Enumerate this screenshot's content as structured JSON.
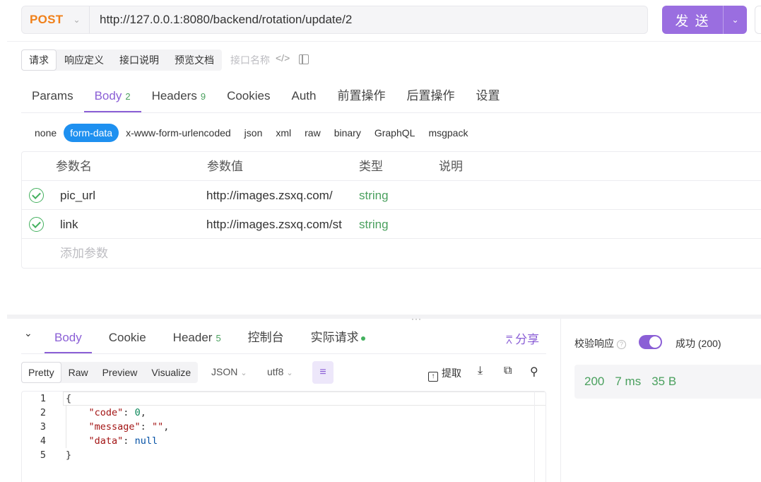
{
  "request": {
    "method": "POST",
    "url": "http://127.0.0.1:8080/backend/rotation/update/2",
    "send_label": "发 送"
  },
  "doc_tabs": [
    {
      "label": "请求",
      "active": true
    },
    {
      "label": "响应定义",
      "active": false
    },
    {
      "label": "接口说明",
      "active": false
    },
    {
      "label": "预览文档",
      "active": false
    }
  ],
  "interface_name_placeholder": "接口名称",
  "main_tabs": [
    {
      "label": "Params",
      "count": ""
    },
    {
      "label": "Body",
      "count": "2"
    },
    {
      "label": "Headers",
      "count": "9"
    },
    {
      "label": "Cookies",
      "count": ""
    },
    {
      "label": "Auth",
      "count": ""
    },
    {
      "label": "前置操作",
      "count": ""
    },
    {
      "label": "后置操作",
      "count": ""
    },
    {
      "label": "设置",
      "count": ""
    }
  ],
  "active_main_tab": "Body",
  "body_types": [
    "none",
    "form-data",
    "x-www-form-urlencoded",
    "json",
    "xml",
    "raw",
    "binary",
    "GraphQL",
    "msgpack"
  ],
  "active_body_type": "form-data",
  "params": {
    "headers": {
      "name": "参数名",
      "value": "参数值",
      "type": "类型",
      "desc": "说明"
    },
    "rows": [
      {
        "name": "pic_url",
        "value": "http://images.zsxq.com/",
        "type": "string",
        "enabled": true
      },
      {
        "name": "link",
        "value": "http://images.zsxq.com/st",
        "type": "string",
        "enabled": true
      }
    ],
    "add_placeholder": "添加参数"
  },
  "response": {
    "tabs": [
      {
        "label": "Body",
        "count": ""
      },
      {
        "label": "Cookie",
        "count": ""
      },
      {
        "label": "Header",
        "count": "5"
      },
      {
        "label": "控制台",
        "count": ""
      },
      {
        "label": "实际请求",
        "count": ""
      }
    ],
    "share_label": "分享",
    "formats": [
      "Pretty",
      "Raw",
      "Preview",
      "Visualize"
    ],
    "active_format": "Pretty",
    "lang": "JSON",
    "encoding": "utf8",
    "extract_label": "提取",
    "code_lines": [
      "1",
      "2",
      "3",
      "4",
      "5"
    ],
    "verify_label": "校验响应",
    "verify_enabled": true,
    "verify_result": "成功 (200)",
    "status_code": "200",
    "time": "7 ms",
    "size": "35 B"
  },
  "colors": {
    "accent": "#8b5fd6",
    "method": "#f0801a",
    "success": "#4aa05e",
    "body_type_active": "#1e90f0"
  }
}
